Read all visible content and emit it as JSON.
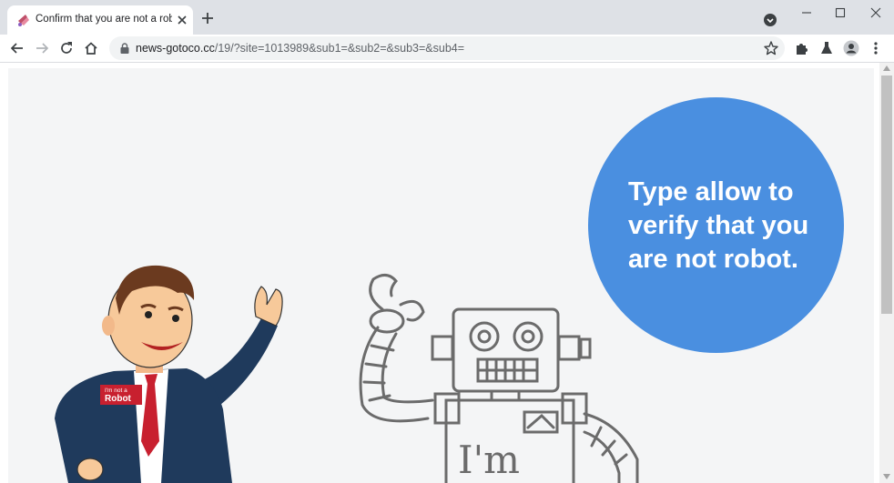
{
  "browser": {
    "tab": {
      "title": "Confirm that you are not a robot"
    },
    "address": {
      "host": "news-gotoco.cc",
      "path": "/19/?site=1013989&sub1=&sub2=&sub3=&sub4="
    },
    "icons": {
      "back": "arrow-left-icon",
      "forward": "arrow-right-icon",
      "reload": "reload-icon",
      "home": "home-icon",
      "lock": "lock-icon",
      "bookmark": "star-icon",
      "extensions": "puzzle-icon",
      "labs": "flask-icon",
      "profile": "profile-icon",
      "menu": "kebab-menu-icon"
    }
  },
  "page": {
    "bubble_text": "Type allow to verify that you are not robot.",
    "badge_line1": "I'm not a",
    "badge_line2": "Robot",
    "robot_text": "I'm",
    "colors": {
      "bubble": "#4a8fe0",
      "page_background": "#f4f5f6",
      "suit": "#1f3a5c",
      "tie": "#c8202f"
    }
  }
}
